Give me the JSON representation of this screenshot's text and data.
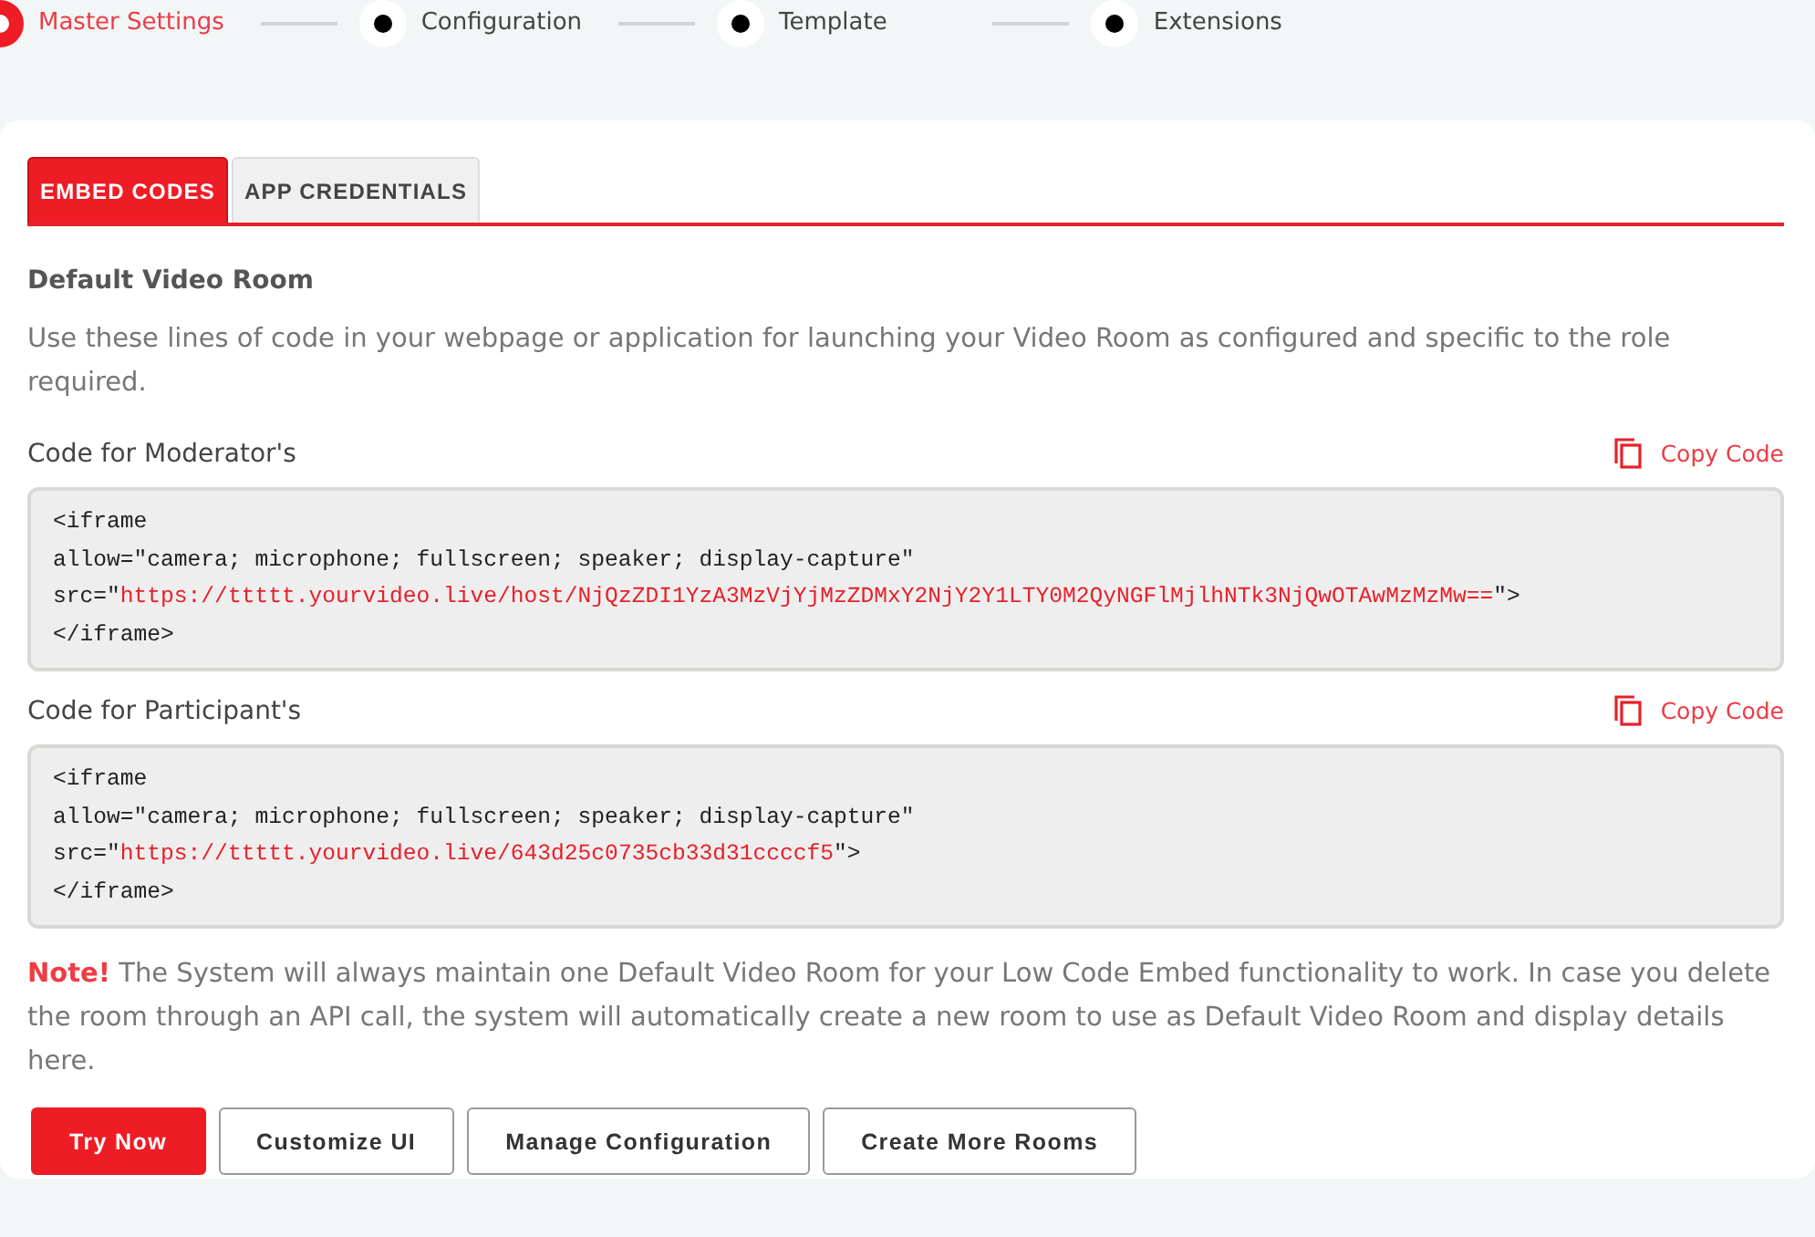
{
  "steps": [
    {
      "label": "Master Settings",
      "selected": true
    },
    {
      "label": "Configuration",
      "selected": false
    },
    {
      "label": "Template",
      "selected": false
    },
    {
      "label": "Extensions",
      "selected": false
    }
  ],
  "tabs": [
    {
      "label": "EMBED CODES",
      "selected": true
    },
    {
      "label": "APP CREDENTIALS",
      "selected": false
    }
  ],
  "section": {
    "title": "Default Video Room",
    "description": "Use these lines of code in your webpage or application for launching your Video Room as configured and specific to the role required."
  },
  "code_blocks": [
    {
      "label": "Code for Moderator's",
      "copy": "Copy Code",
      "lines": [
        {
          "kind": "plain",
          "text": "<iframe"
        },
        {
          "kind": "plain",
          "text": "allow=\"camera; microphone; fullscreen; speaker; display-capture\""
        },
        {
          "kind": "src",
          "prefix": "src=\"",
          "url": "https://ttttt.yourvideo.live/host/NjQzZDI1YzA3MzVjYjMzZDMxY2NjY2Y1LTY0M2QyNGFlMjlhNTk3NjQwOTAwMzMzMw==",
          "suffix": "\">"
        },
        {
          "kind": "plain",
          "text": "</iframe>"
        }
      ]
    },
    {
      "label": "Code for Participant's",
      "copy": "Copy Code",
      "lines": [
        {
          "kind": "plain",
          "text": "<iframe"
        },
        {
          "kind": "plain",
          "text": "allow=\"camera; microphone; fullscreen; speaker; display-capture\""
        },
        {
          "kind": "src",
          "prefix": "src=\"",
          "url": "https://ttttt.yourvideo.live/643d25c0735cb33d31ccccf5",
          "suffix": "\">"
        },
        {
          "kind": "plain",
          "text": "</iframe>"
        }
      ]
    }
  ],
  "note": "**Note!** The System will always maintain one Default Video Room for your Low Code Embed functionality to work. In case you delete the room through an API call, the system will automatically create a new room to use as Default Video Room and display details here.",
  "buttons": [
    {
      "label": "Try Now",
      "kind": "primary"
    },
    {
      "label": "Customize UI",
      "kind": "secondary"
    },
    {
      "label": "Manage Configuration",
      "kind": "secondary"
    },
    {
      "label": "Create More Rooms",
      "kind": "secondary"
    }
  ]
}
